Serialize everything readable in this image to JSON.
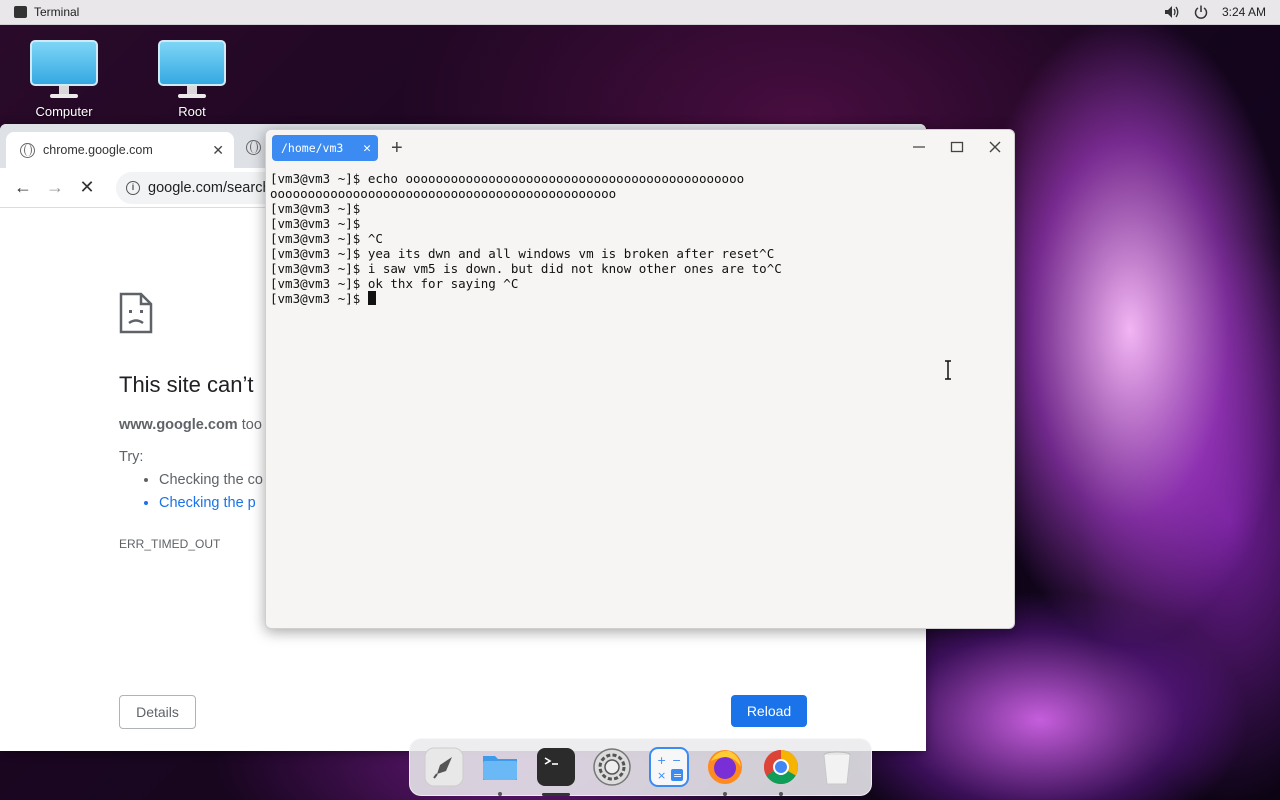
{
  "top_panel": {
    "app_name": "Terminal",
    "clock": "3:24 AM"
  },
  "desktop": {
    "icons": [
      {
        "label": "Computer",
        "icon": "monitor-icon"
      },
      {
        "label": "Root",
        "icon": "monitor-icon"
      }
    ]
  },
  "chrome": {
    "tab_title": "chrome.google.com",
    "address": "google.com/search",
    "error": {
      "title": "This site can’t",
      "host_bold": "www.google.com",
      "host_rest": " too",
      "try_label": "Try:",
      "suggestions": [
        "Checking the co",
        "Checking the p"
      ],
      "code": "ERR_TIMED_OUT"
    },
    "details_label": "Details",
    "reload_label": "Reload"
  },
  "terminal": {
    "tab_title": "/home/vm3",
    "lines": [
      "[vm3@vm3 ~]$ echo ooooooooooooooooooooooooooooooooooooooooooooo",
      "oooooooooooooooooooooooooooooooooooooooooooooo",
      "[vm3@vm3 ~]$",
      "[vm3@vm3 ~]$",
      "[vm3@vm3 ~]$ ^C",
      "[vm3@vm3 ~]$ yea its dwn and all windows vm is broken after reset^C",
      "[vm3@vm3 ~]$ i saw vm5 is down. but did not know other ones are to^C",
      "[vm3@vm3 ~]$ ok thx for saying ^C"
    ],
    "prompt": "[vm3@vm3 ~]$ "
  },
  "dock": {
    "items": [
      "launcher-icon",
      "files-icon",
      "terminal-icon",
      "settings-icon",
      "calculator-icon",
      "firefox-icon",
      "chrome-icon",
      "trash-icon"
    ]
  },
  "colors": {
    "accent": "#3b8bf3",
    "reload": "#1a73e8"
  }
}
